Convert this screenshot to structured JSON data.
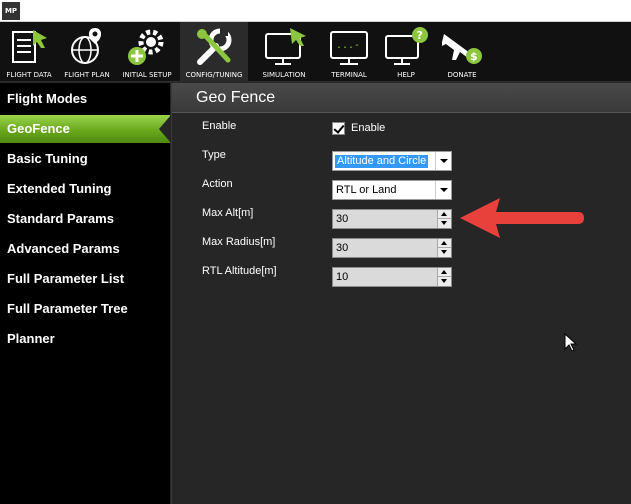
{
  "app": {
    "icon_text": "MP"
  },
  "toolbar": {
    "items": [
      {
        "label": "FLIGHT DATA",
        "icon": "flight-data-icon"
      },
      {
        "label": "FLIGHT PLAN",
        "icon": "flight-plan-icon"
      },
      {
        "label": "INITIAL SETUP",
        "icon": "initial-setup-icon"
      },
      {
        "label": "CONFIG/TUNING",
        "icon": "config-tuning-icon",
        "active": true
      },
      {
        "label": "SIMULATION",
        "icon": "simulation-icon"
      },
      {
        "label": "TERMINAL",
        "icon": "terminal-icon"
      },
      {
        "label": "HELP",
        "icon": "help-icon"
      },
      {
        "label": "DONATE",
        "icon": "donate-icon"
      }
    ]
  },
  "sidebar": {
    "items": [
      {
        "label": "Flight Modes"
      },
      {
        "label": "GeoFence",
        "active": true
      },
      {
        "label": "Basic Tuning"
      },
      {
        "label": "Extended Tuning"
      },
      {
        "label": "Standard Params"
      },
      {
        "label": "Advanced Params"
      },
      {
        "label": "Full Parameter List"
      },
      {
        "label": "Full Parameter Tree"
      },
      {
        "label": "Planner"
      }
    ]
  },
  "panel": {
    "title": "Geo Fence",
    "fields": {
      "enable": {
        "label": "Enable",
        "checkbox_label": "Enable",
        "checked": true
      },
      "type": {
        "label": "Type",
        "value": "Altitude and Circle"
      },
      "action": {
        "label": "Action",
        "value": "RTL or Land"
      },
      "max_alt": {
        "label": "Max Alt[m]",
        "value": "30"
      },
      "max_radius": {
        "label": "Max Radius[m]",
        "value": "30"
      },
      "rtl_altitude": {
        "label": "RTL Altitude[m]",
        "value": "10"
      }
    }
  },
  "colors": {
    "accent_green": "#6aa81e",
    "annotation_red": "#e8413c",
    "background": "#262626",
    "sidebar": "#000000",
    "toolbar": "#111111"
  }
}
